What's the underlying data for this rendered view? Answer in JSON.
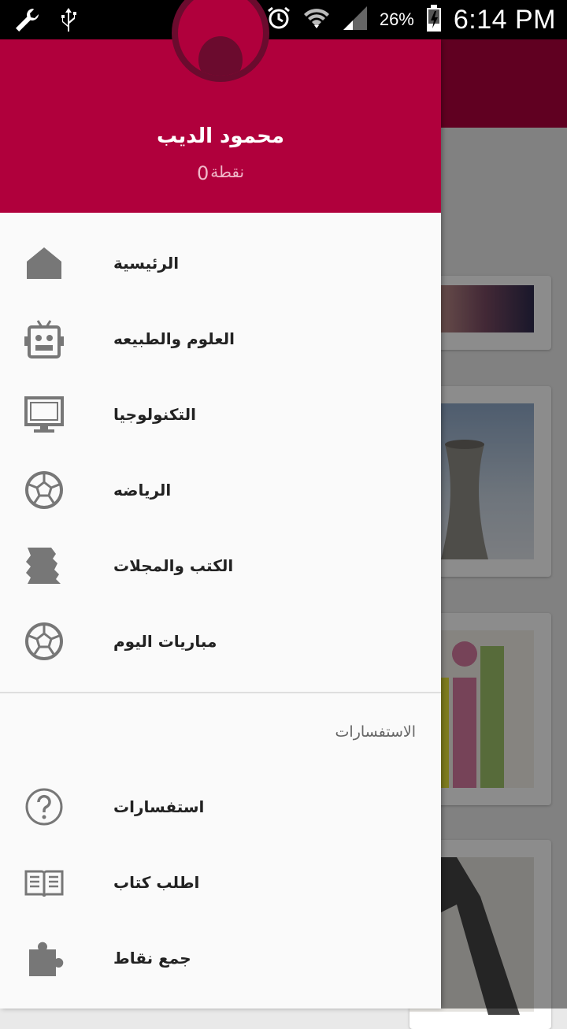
{
  "status_bar": {
    "battery_percent": "26%",
    "time": "6:14 PM"
  },
  "drawer": {
    "user_name": "محمود الديب",
    "points_value": "0",
    "points_label": "نقطة",
    "menu": [
      {
        "label": "الرئيسية",
        "icon": "home-icon"
      },
      {
        "label": "العلوم والطبيعه",
        "icon": "robot-icon"
      },
      {
        "label": "التكنولوجيا",
        "icon": "monitor-icon"
      },
      {
        "label": "الرياضه",
        "icon": "soccer-ball-icon"
      },
      {
        "label": "الكتب والمجلات",
        "icon": "torn-paper-icon"
      },
      {
        "label": "مباريات اليوم",
        "icon": "soccer-ball-icon"
      }
    ],
    "section_title": "الاستفسارات",
    "menu2": [
      {
        "label": "استفسارات",
        "icon": "help-icon"
      },
      {
        "label": "اطلب كتاب",
        "icon": "book-icon"
      },
      {
        "label": "جمع نقاط",
        "icon": "puzzle-icon"
      }
    ]
  },
  "colors": {
    "primary": "#b0003c",
    "primary_dark": "#6b0b2e",
    "icon_gray": "#777777"
  }
}
